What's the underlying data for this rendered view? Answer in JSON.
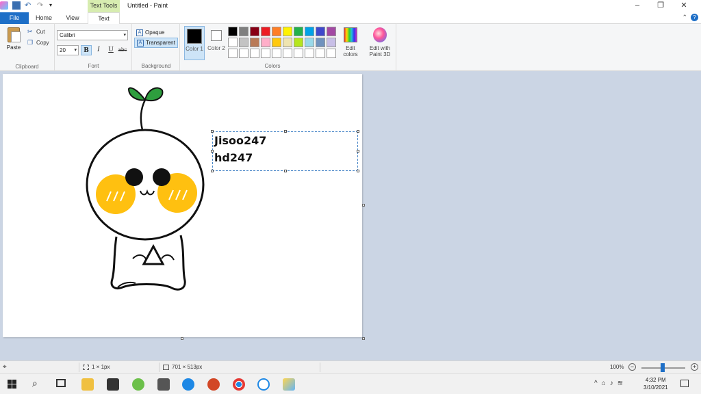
{
  "window": {
    "title": "Untitled - Paint",
    "context_tab": "Text Tools",
    "buttons": {
      "minimize": "–",
      "restore": "❐",
      "close": "✕"
    }
  },
  "tabs": [
    "File",
    "Home",
    "View",
    "Text"
  ],
  "ribbon": {
    "clipboard": {
      "paste": "Paste",
      "cut": "Cut",
      "copy": "Copy",
      "label": "Clipboard"
    },
    "font": {
      "family": "Calibri",
      "size": "20",
      "bold": "B",
      "italic": "I",
      "underline": "U",
      "strike": "abc",
      "label": "Font"
    },
    "background": {
      "opaque": "Opaque",
      "transparent": "Transparent",
      "label": "Background"
    },
    "colors": {
      "color1": "Color 1",
      "color2": "Color 2",
      "color1_value": "#000000",
      "color2_value": "#ffffff",
      "palette": [
        "#000000",
        "#7f7f7f",
        "#880015",
        "#ed1c24",
        "#ff7f27",
        "#fff200",
        "#22b14c",
        "#00a2e8",
        "#3f48cc",
        "#a349a4",
        "#ffffff",
        "#c3c3c3",
        "#b97a57",
        "#ffaec9",
        "#ffc90e",
        "#efe4b0",
        "#b5e61d",
        "#99d9ea",
        "#7092be",
        "#c8bfe7",
        "#ffffff",
        "#ffffff",
        "#ffffff",
        "#ffffff",
        "#ffffff",
        "#ffffff",
        "#ffffff",
        "#ffffff",
        "#ffffff",
        "#ffffff"
      ],
      "edit_colors": "Edit colors",
      "edit_paint3d": "Edit with Paint 3D",
      "label": "Colors"
    }
  },
  "canvas": {
    "text_lines": [
      "Jisoo247",
      "hd247"
    ]
  },
  "statusbar": {
    "cursor_pos": "",
    "selection_size": "1 × 1px",
    "image_size": "701 × 513px",
    "zoom": "100%"
  },
  "taskbar": {
    "time": "4:32 PM",
    "date": "3/10/2021"
  }
}
